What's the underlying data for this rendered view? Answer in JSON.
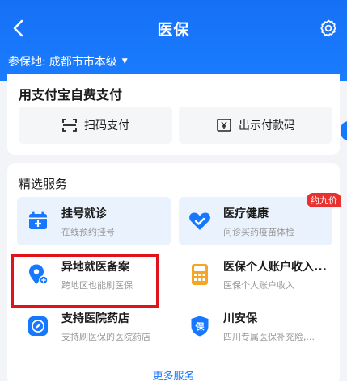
{
  "header": {
    "title": "医保",
    "location_label": "参保地:",
    "location_value": "成都市市本级"
  },
  "pay": {
    "title": "用支付宝自费支付",
    "scan_label": "扫码支付",
    "show_label": "出示付款码"
  },
  "services": {
    "title": "精选服务",
    "items": [
      {
        "name": "挂号就诊",
        "sub": "在线预约挂号",
        "icon": "calendar-plus-icon"
      },
      {
        "name": "医疗健康",
        "sub": "问诊买药疫苗体检",
        "icon": "heart-icon",
        "badge": "约九价"
      },
      {
        "name": "异地就医备案",
        "sub": "跨地区也能刷医保",
        "icon": "location-plus-icon"
      },
      {
        "name": "医保个人账户收入...",
        "sub": "医保个人账户收入",
        "icon": "calculator-icon"
      },
      {
        "name": "支持医院药店",
        "sub": "支持刷医保的医院药店",
        "icon": "compass-icon"
      },
      {
        "name": "川安保",
        "sub": "四川专属医保补充险,...",
        "icon": "shield-bao-icon",
        "icon_text": "保"
      }
    ],
    "more_label": "更多服务"
  },
  "colors": {
    "primary": "#1677ff",
    "highlight": "#e0131a",
    "badge": "#e8312e",
    "calculator": "#f5a623"
  }
}
